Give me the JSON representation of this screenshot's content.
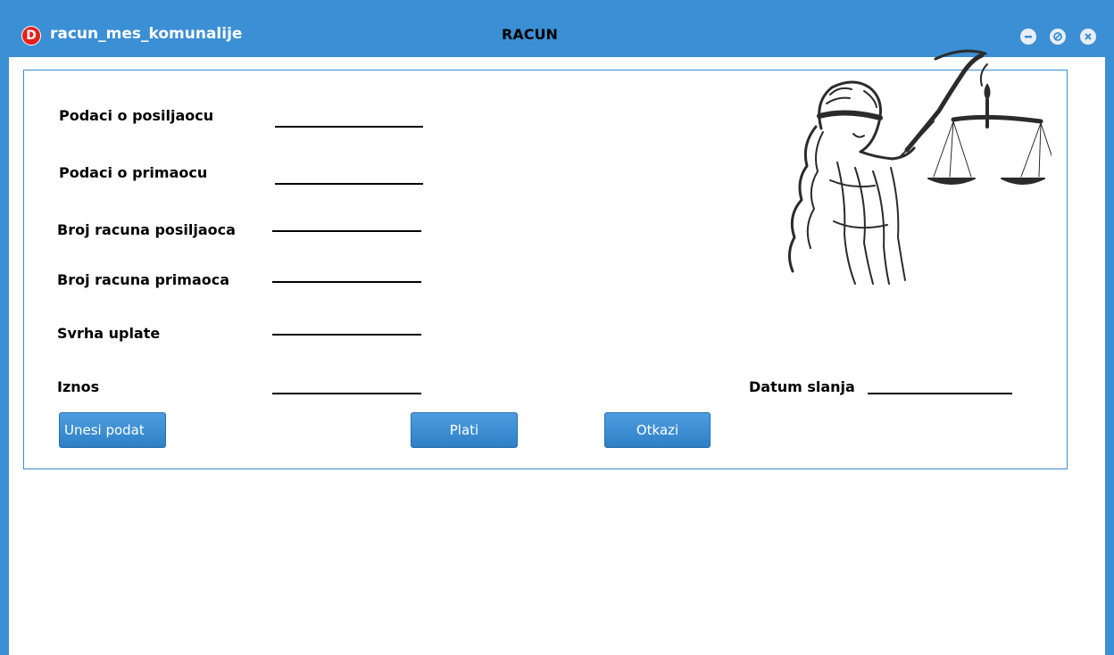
{
  "window": {
    "title": "racun_mes_komunalije",
    "app_icon_letter": "D",
    "controls": [
      "minimize-icon",
      "maximize-icon",
      "close-icon"
    ]
  },
  "form": {
    "heading": "RACUN",
    "fields": {
      "sender_info": "Podaci o posiljaocu",
      "recipient_info": "Podaci o primaocu",
      "sender_account": "Broj racuna posiljaoca",
      "recipient_account": "Broj racuna primaoca",
      "purpose": "Svrha uplate",
      "amount": "Iznos",
      "send_date": "Datum slanja"
    },
    "buttons": {
      "enter_data": "Unesi podat",
      "pay": "Plati",
      "cancel": "Otkazi"
    }
  },
  "colors": {
    "accent": "#3b8fd4",
    "button": "#3a8dd4",
    "icon_red": "#e32119"
  },
  "illustration": "lady-justice-icon"
}
